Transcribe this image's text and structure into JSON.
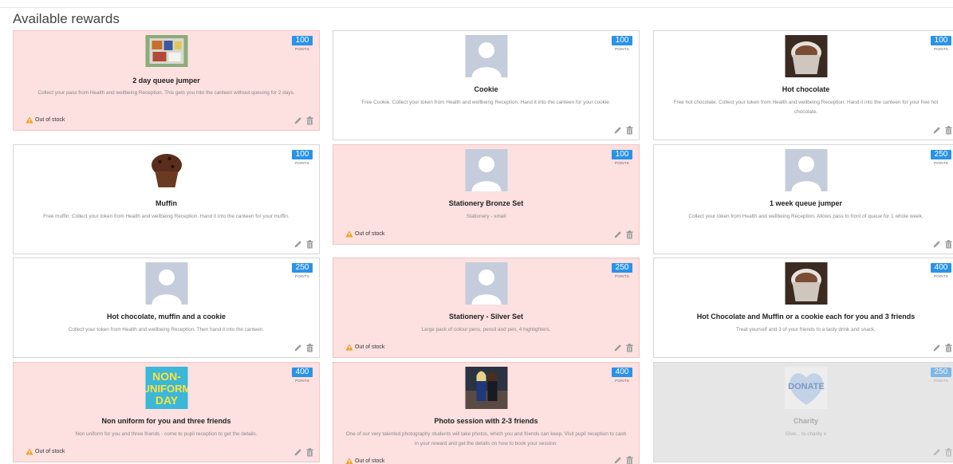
{
  "page": {
    "title": "Available rewards"
  },
  "rewards": [
    {
      "title": "2 day queue jumper",
      "points": "100",
      "points_label": "POINTS",
      "description": "Collect your pass from Health and wellbeing Reception. This gets you into the canteen without queuing for 2 days.",
      "status": "Out of stock",
      "image": "canteen-tray-photo"
    },
    {
      "title": "Cookie",
      "points": "100",
      "points_label": "POINTS",
      "description": "Free Cookie. Collect your token from Health and wellbeing Reception. Hand it into the canteen for your cookie.",
      "status": "",
      "image": "placeholder-avatar"
    },
    {
      "title": "Hot chocolate",
      "points": "100",
      "points_label": "POINTS",
      "description": "Free hot chocolate. Collect your token from Health and wellbeing Reception. Hand it into the canteen for your free hot chocolate.",
      "status": "",
      "image": "hot-chocolate-photo"
    },
    {
      "title": "Muffin",
      "points": "100",
      "points_label": "POINTS",
      "description": "Free muffin. Collect your token from Health and wellbeing Reception. Hand it into the canteen for your muffin.",
      "status": "",
      "image": "muffin-photo"
    },
    {
      "title": "Stationery Bronze Set",
      "points": "100",
      "points_label": "POINTS",
      "description": "Stationery - small",
      "status": "Out of stock",
      "image": "placeholder-avatar"
    },
    {
      "title": "1 week queue jumper",
      "points": "250",
      "points_label": "POINTS",
      "description": "Collect your token from Health and wellbeing Reception. Allows pass to front of queue for 1 whole week.",
      "status": "",
      "image": "placeholder-avatar"
    },
    {
      "title": "Hot chocolate, muffin and a cookie",
      "points": "250",
      "points_label": "POINTS",
      "description": "Collect your token from Health and wellbeing Reception. Then hand it into the canteen.",
      "status": "",
      "image": "placeholder-avatar"
    },
    {
      "title": "Stationery - Silver Set",
      "points": "250",
      "points_label": "POINTS",
      "description": "Large pack of colour pens, pencil and pen, 4 highlighters.",
      "status": "Out of stock",
      "image": "placeholder-avatar"
    },
    {
      "title": "Hot Chocolate and Muffin or a cookie each for you and 3 friends",
      "points": "400",
      "points_label": "POINTS",
      "description": "Treat yourself and 3 of your friends to a tasty drink and snack.",
      "status": "",
      "image": "hot-chocolate-photo"
    },
    {
      "title": "Non uniform for you and three friends",
      "points": "400",
      "points_label": "POINTS",
      "description": "Non uniform for you and three friends - come to pupil reception to get the details.",
      "status": "Out of stock",
      "image": "non-uniform-day-graphic",
      "image_text": [
        "NON-",
        "UNIFORM",
        "DAY"
      ]
    },
    {
      "title": "Photo session with 2-3 friends",
      "points": "400",
      "points_label": "POINTS",
      "description": "One of our very talented photography students will take photos, which you and friends can keep. Visit pupil reception to cash in your reward and get the details on how to book your session.",
      "status": "Out of stock",
      "image": "friends-photo"
    },
    {
      "title": "Charity",
      "points": "250",
      "points_label": "POINTS",
      "description": "Give... to charity x",
      "status": "",
      "image": "donate-heart-graphic",
      "image_text": [
        "DONATE"
      ]
    }
  ],
  "colors": {
    "accent": "#2a93e8",
    "out_of_stock_bg": "#fde0e0",
    "warning": "#f0a020",
    "disabled_bg": "#e6e6e6"
  }
}
